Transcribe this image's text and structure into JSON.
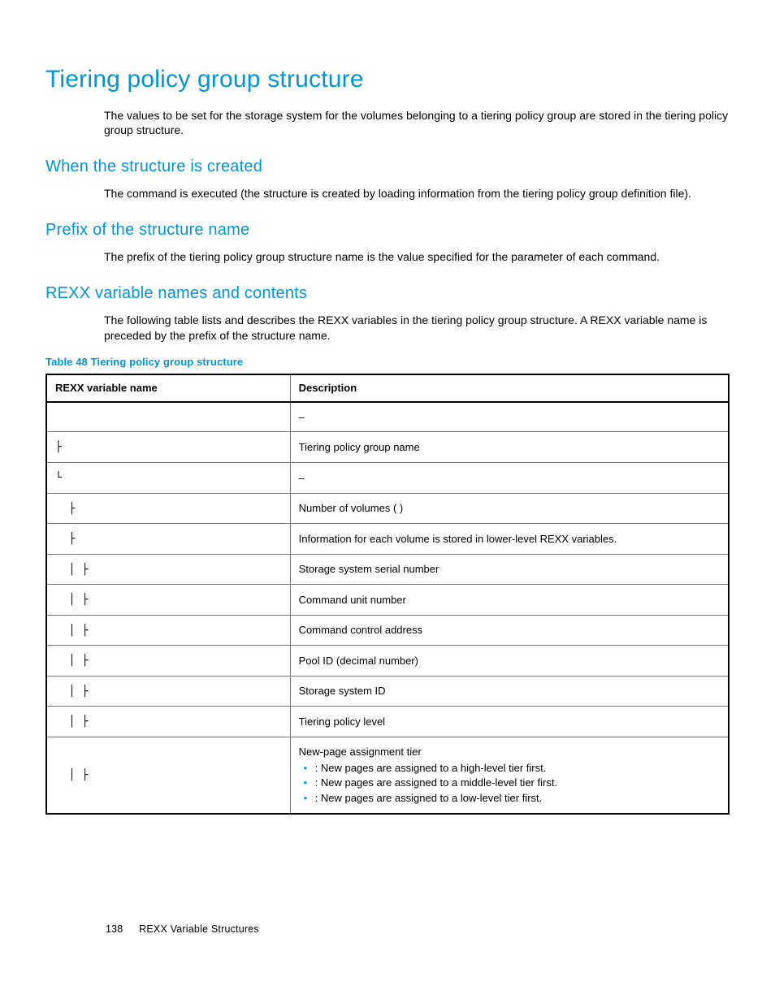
{
  "title": "Tiering policy group structure",
  "intro": "The values to be set for the storage system for the volumes belonging to a tiering policy group are stored in the tiering policy group structure.",
  "sections": {
    "s1": {
      "heading": "When the structure is created",
      "body": "The                command is executed (the structure is created by loading information from the tiering policy group definition file)."
    },
    "s2": {
      "heading": "Prefix of the structure name",
      "body": "The prefix of the tiering policy group structure name is the value specified for the              parameter of each command."
    },
    "s3": {
      "heading": "REXX variable names and contents",
      "body": "The following table lists and describes the REXX variables in the tiering policy group structure. A REXX variable name is preceded by the prefix of the structure name."
    }
  },
  "table": {
    "caption": "Table 48 Tiering policy group structure",
    "head": {
      "c1": "REXX variable name",
      "c2": "Description"
    },
    "rows": [
      {
        "name": "",
        "desc_type": "dash"
      },
      {
        "name": "├",
        "desc_type": "text",
        "desc": "Tiering policy group name"
      },
      {
        "name": "└",
        "desc_type": "dash"
      },
      {
        "name": "    ├",
        "desc_type": "text",
        "desc": "Number of volumes (  )"
      },
      {
        "name": "    ├",
        "desc_type": "text",
        "desc": "Information for each volume is stored in lower-level REXX variables."
      },
      {
        "name": "    │  ├",
        "desc_type": "text",
        "desc": "Storage system serial number"
      },
      {
        "name": "    │  ├",
        "desc_type": "text",
        "desc": "Command unit number"
      },
      {
        "name": "    │  ├",
        "desc_type": "text",
        "desc": "Command control address"
      },
      {
        "name": "    │  ├",
        "desc_type": "text",
        "desc": "Pool ID (decimal number)"
      },
      {
        "name": "    │  ├",
        "desc_type": "text",
        "desc": "Storage system ID"
      },
      {
        "name": "    │  ├",
        "desc_type": "text",
        "desc": "Tiering policy level"
      },
      {
        "name": "    │  ├",
        "desc_type": "list",
        "desc": "New-page assignment tier",
        "items": [
          "       : New pages are assigned to a high-level tier first.",
          "          : New pages are assigned to a middle-level tier first.",
          "       : New pages are assigned to a low-level tier first."
        ]
      }
    ]
  },
  "footer": {
    "page": "138",
    "section": "REXX Variable Structures"
  }
}
